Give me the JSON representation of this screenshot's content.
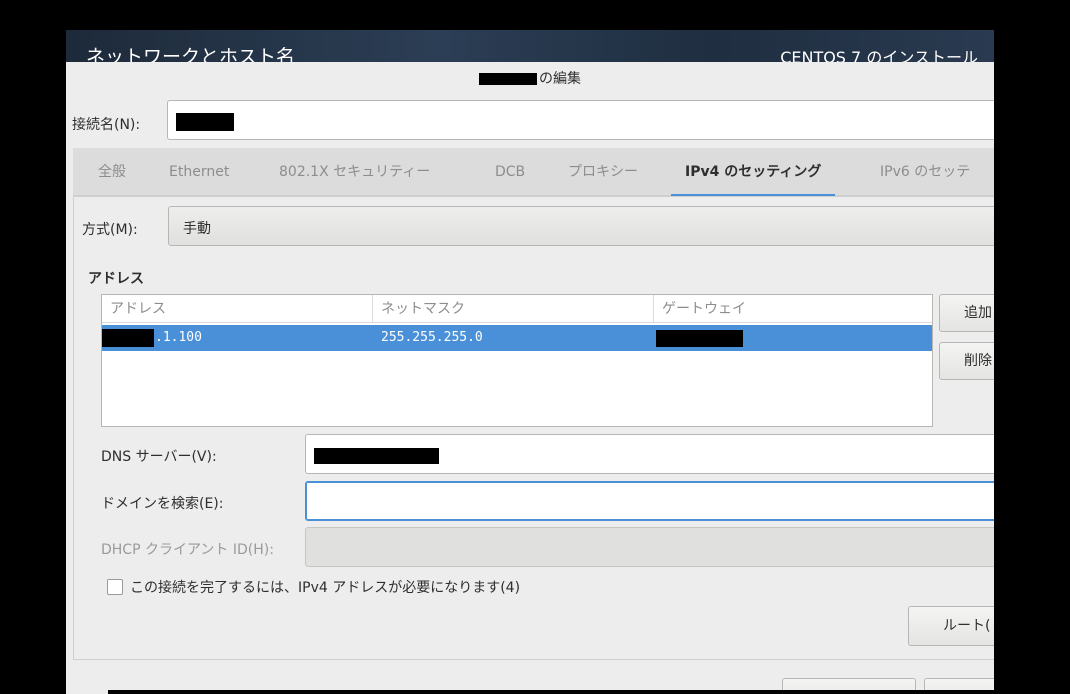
{
  "header": {
    "title": "ネットワークとホスト名",
    "product": "CENTOS 7 のインストール"
  },
  "dialog": {
    "title_suffix": "の編集",
    "connection_label": "接続名(N):",
    "tabs": [
      {
        "label": "全般",
        "active": false
      },
      {
        "label": "Ethernet",
        "active": false
      },
      {
        "label": "802.1X セキュリティー",
        "active": false
      },
      {
        "label": "DCB",
        "active": false
      },
      {
        "label": "プロキシー",
        "active": false
      },
      {
        "label": "IPv4 のセッティング",
        "active": true
      },
      {
        "label": "IPv6 のセッテ",
        "active": false
      }
    ],
    "method": {
      "label": "方式(M):",
      "value": "手動"
    },
    "address_section": "アドレス",
    "table": {
      "headers": [
        "アドレス",
        "ネットマスク",
        "ゲートウェイ"
      ],
      "rows": [
        {
          "address": ".1.100",
          "netmask": "255.255.255.0",
          "gateway": ""
        }
      ]
    },
    "buttons": {
      "add": "追加",
      "delete": "削除",
      "routes": "ルート("
    },
    "dns": {
      "label": "DNS サーバー(V):",
      "value": ""
    },
    "search_domain": {
      "label": "ドメインを検索(E):",
      "value": ""
    },
    "dhcp_client_id": {
      "label": "DHCP クライアント ID(H):",
      "value": ""
    },
    "require_ipv4": {
      "label": "この接続を完了するには、IPv4 アドレスが必要になります(4)",
      "checked": false
    }
  },
  "colors": {
    "accent": "#4a90d9",
    "background": "#ededed",
    "redaction": "#000000"
  }
}
